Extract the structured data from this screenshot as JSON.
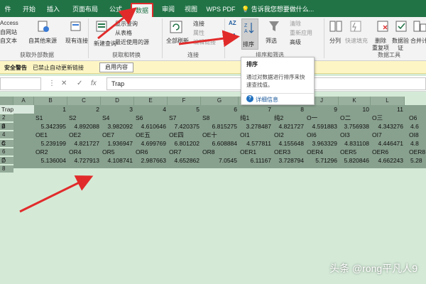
{
  "ribbon_tabs": [
    {
      "label": "件",
      "active": false
    },
    {
      "label": "开始",
      "active": false
    },
    {
      "label": "插入",
      "active": false
    },
    {
      "label": "页面布局",
      "active": false
    },
    {
      "label": "公式",
      "active": false
    },
    {
      "label": "数据",
      "active": true
    },
    {
      "label": "审阅",
      "active": false
    },
    {
      "label": "视图",
      "active": false
    },
    {
      "label": "WPS PDF",
      "active": false
    }
  ],
  "tell_me": "告诉我您想要做什么...",
  "ribbon": {
    "get_external": {
      "access": "Access",
      "web": "自网站",
      "text": "自文本",
      "other_sources": "自其他来源",
      "existing": "现有连接",
      "group_label": "获取外部数据"
    },
    "get_transform": {
      "show_query": "显示查询",
      "from_table": "从表格",
      "recent_sources": "最近使用的源",
      "new_query": "新建查询",
      "group_label": "获取和转换"
    },
    "connections": {
      "refresh_all": "全部刷新",
      "connections": "连接",
      "properties": "属性",
      "edit_links": "编辑链接",
      "group_label": "连接"
    },
    "sort_filter": {
      "sort_az": "AZ",
      "sort_za": "ZA",
      "sort": "排序",
      "filter": "筛选",
      "clear": "清除",
      "reapply": "重新应用",
      "advanced": "高级",
      "group_label": "排序和筛选"
    },
    "data_tools": {
      "split": "分列",
      "flash_fill": "快速填充",
      "remove_dup": "删除",
      "remove_dup2": "重复项",
      "validation": "数据验",
      "validation2": "证",
      "consolidate": "合并计",
      "group_label": "数据工具"
    }
  },
  "tooltip": {
    "title": "排序",
    "description": "通过对数据进行排序来快速查找值。",
    "more": "详细信息"
  },
  "security": {
    "title": "安全警告",
    "message": "已禁止自动更新链接",
    "button": "启用内容"
  },
  "formula_bar": {
    "name_box": "",
    "cancel": "✕",
    "enter": "✓",
    "fx": "fx",
    "value": "Trap"
  },
  "columns": [
    "A",
    "B",
    "C",
    "D",
    "E",
    "F",
    "G",
    "H",
    "I",
    "J",
    "K",
    "L"
  ],
  "rows": [
    "1",
    "2",
    "3",
    "4",
    "5",
    "6",
    "7",
    "8"
  ],
  "sheet": {
    "a_column": [
      "Trap",
      "",
      "B",
      "",
      "C",
      "",
      "D"
    ],
    "row1_numbers": [
      "1",
      "2",
      "3",
      "4",
      "5",
      "6",
      "7",
      "8",
      "9",
      "10",
      "11"
    ],
    "row_labels": [
      [
        "S1",
        "S2",
        "S4",
        "S6",
        "S7",
        "S8",
        "纯1",
        "纯2",
        "O一",
        "O二",
        "O三",
        "O6"
      ],
      [
        "OE1",
        "OE2",
        "OE7",
        "OE五",
        "OE四",
        "OE十",
        "OI1",
        "OI2",
        "OI6",
        "OI3",
        "OI7",
        "OI8"
      ],
      [
        "OR2",
        "OR4",
        "OR5",
        "OR6",
        "OR7",
        "OR8",
        "OER1",
        "OER3",
        "OER4",
        "OER5",
        "OER6",
        "OER8"
      ]
    ],
    "row_values": [
      [
        "5.342395",
        "4.892088",
        "3.982092",
        "4.610646",
        "7.420375",
        "6.815275",
        "3.278487",
        "4.821727",
        "4.591883",
        "3.756938",
        "4.343276",
        "4.6"
      ],
      [
        "5.239199",
        "4.821727",
        "1.936947",
        "4.699769",
        "6.801202",
        "6.608884",
        "4.577811",
        "4.155648",
        "3.963329",
        "4.831108",
        "4.446471",
        "4.8"
      ],
      [
        "5.136004",
        "4.727913",
        "4.108741",
        "2.987663",
        "4.652862",
        "7.0545",
        "6.11167",
        "3.728794",
        "5.71296",
        "5.820846",
        "4.662243",
        "5.28"
      ]
    ]
  },
  "watermark": "头条 @rong平凡人9",
  "colors": {
    "ribbon_green": "#217346",
    "sheet_bg": "#d4ead7",
    "selection": "#88a08e",
    "arrow_red": "#e12b2b"
  }
}
